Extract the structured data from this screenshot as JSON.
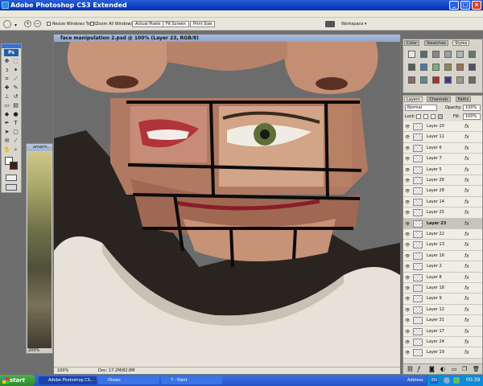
{
  "window": {
    "title": "Adobe Photoshop CS3 Extended"
  },
  "options_bar": {
    "resize_label": "Resize Windows To Fit",
    "zoom_all_label": "Zoom All Windows",
    "actual_pixels": "Actual Pixels",
    "fit_screen": "Fit Screen",
    "print_size": "Print Size",
    "workspace": "Workspace ▾"
  },
  "toolbox": {
    "logo": "Ps"
  },
  "document_small": {
    "title": "amarin...",
    "zoom": "200%"
  },
  "document": {
    "title": "face manipulation 2.psd @ 100% (Layer 23, RGB/8)",
    "zoom": "100%",
    "doc_size": "Doc: 17.2M/82.8M"
  },
  "swatch_panel": {
    "tabs": [
      "Color",
      "Swatches",
      "Styles"
    ],
    "active_tab": "Styles",
    "colors": [
      "#e8e8e8",
      "#5a6a7a",
      "#888888",
      "#9aa0a8",
      "#b0b4b8",
      "#6a7a6a",
      "#5a5a5a",
      "#4a7ab0",
      "#7ab07a",
      "#8a8a5a",
      "#a07050",
      "#50506a",
      "#8a6a6a",
      "#5a8a8a",
      "#aa3030",
      "#3a3a8a",
      "#9a9a9a",
      "#6a6a6a"
    ]
  },
  "layers_panel": {
    "tabs": [
      "Layers",
      "Channels",
      "Paths"
    ],
    "active_tab": "Layers",
    "blend_mode": "Normal",
    "opacity_label": "Opacity:",
    "opacity_value": "100%",
    "lock_label": "Lock:",
    "fill_label": "Fill:",
    "fill_value": "100%",
    "fx_symbol": "fx",
    "selected_layer": "Layer 23",
    "layers": [
      "Layer 20",
      "Layer 11",
      "Layer 6",
      "Layer 7",
      "Layer 5",
      "Layer 26",
      "Layer 28",
      "Layer 14",
      "Layer 25",
      "Layer 23",
      "Layer 22",
      "Layer 13",
      "Layer 16",
      "Layer 2",
      "Layer 8",
      "Layer 18",
      "Layer 9",
      "Layer 12",
      "Layer 31",
      "Layer 17",
      "Layer 24",
      "Layer 19"
    ]
  },
  "taskbar": {
    "start": "start",
    "tasks": [
      "Adobe Photoshop CS...",
      "iTunes",
      "7 - Paint"
    ],
    "address_label": "Address",
    "lang": "EN",
    "time": "00:39"
  }
}
